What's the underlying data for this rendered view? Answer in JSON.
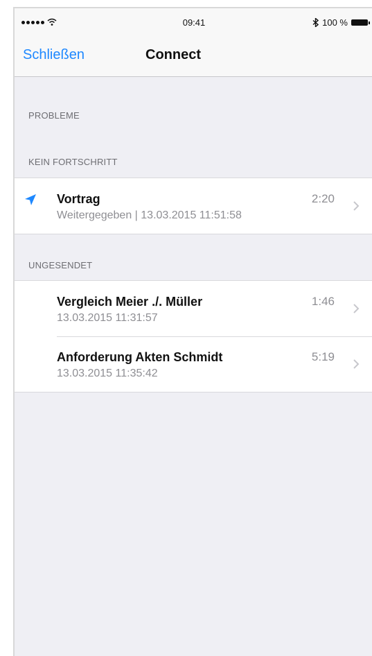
{
  "status_bar": {
    "time": "09:41",
    "battery": "100 %"
  },
  "nav": {
    "close_label": "Schließen",
    "title": "Connect"
  },
  "sections": {
    "problems_header": "PROBLEME",
    "no_progress_header": "KEIN FORTSCHRITT",
    "unsent_header": "UNGESENDET"
  },
  "no_progress_items": [
    {
      "title": "Vortrag",
      "subtitle": "Weitergegeben | 13.03.2015 11:51:58",
      "duration": "2:20",
      "icon": "send-icon"
    }
  ],
  "unsent_items": [
    {
      "title": "Vergleich Meier ./. Müller",
      "subtitle": "13.03.2015 11:31:57",
      "duration": "1:46"
    },
    {
      "title": "Anforderung Akten Schmidt",
      "subtitle": "13.03.2015 11:35:42",
      "duration": "5:19"
    }
  ],
  "colors": {
    "accent": "#1e88ff",
    "background": "#efeff4",
    "secondary_text": "#8e8e93"
  }
}
